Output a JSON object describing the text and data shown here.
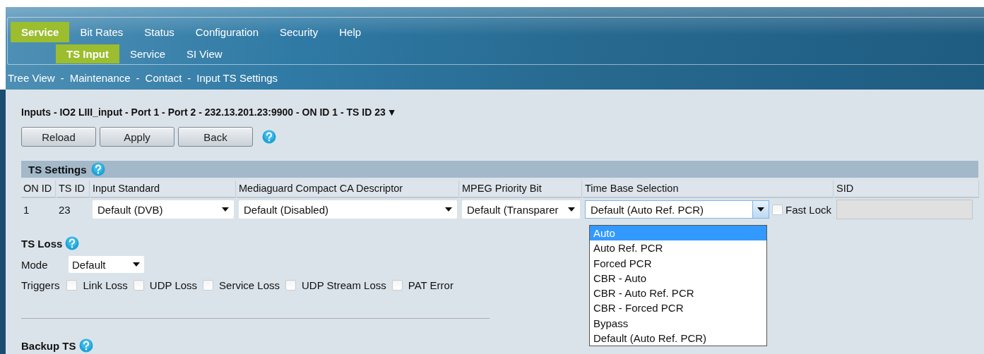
{
  "menu": [
    {
      "label": "Service",
      "selected": true
    },
    {
      "label": "Bit Rates",
      "selected": false
    },
    {
      "label": "Status",
      "selected": false
    },
    {
      "label": "Configuration",
      "selected": false
    },
    {
      "label": "Security",
      "selected": false
    },
    {
      "label": "Help",
      "selected": false
    }
  ],
  "submenu": [
    {
      "label": "TS Input",
      "selected": true
    },
    {
      "label": "Service",
      "selected": false
    },
    {
      "label": "SI View",
      "selected": false
    }
  ],
  "breadcrumb": [
    "Tree View",
    "-",
    "Maintenance",
    "-",
    "Contact",
    "-",
    "Input TS Settings"
  ],
  "page_title": {
    "text": "Inputs - IO2 LIII_input - Port 1 - Port 2 - 232.13.201.23:9900 - ON ID 1 - TS ID 23",
    "toggle": "▼"
  },
  "buttons": [
    "Reload",
    "Apply",
    "Back"
  ],
  "ts_settings": {
    "title": "TS Settings",
    "columns": [
      "ON ID",
      "TS ID",
      "Input Standard",
      "Mediaguard Compact CA Descriptor",
      "MPEG Priority Bit",
      "Time Base Selection",
      "SID"
    ],
    "row": [
      {
        "kind": "text",
        "value": "1"
      },
      {
        "kind": "text",
        "value": "23"
      },
      {
        "kind": "select",
        "value": "Default (DVB)"
      },
      {
        "kind": "select",
        "value": "Default (Disabled)"
      },
      {
        "kind": "select",
        "value": "Default (Transparer"
      },
      {
        "kind": "timebase",
        "value": "Default (Auto Ref. PCR)",
        "expanded": true,
        "options": [
          {
            "label": "Auto",
            "highlighted": true
          },
          {
            "label": "Auto Ref. PCR",
            "highlighted": false
          },
          {
            "label": "Forced PCR",
            "highlighted": false
          },
          {
            "label": "CBR - Auto",
            "highlighted": false
          },
          {
            "label": "CBR - Auto Ref. PCR",
            "highlighted": false
          },
          {
            "label": "CBR - Forced PCR",
            "highlighted": false
          },
          {
            "label": "Bypass",
            "highlighted": false
          },
          {
            "label": "Default (Auto Ref. PCR)",
            "highlighted": false
          }
        ],
        "fast_lock": {
          "label": "Fast Lock",
          "checked": false
        }
      },
      {
        "kind": "input",
        "disabled": true
      }
    ]
  },
  "ts_loss": {
    "title": "TS Loss",
    "mode": {
      "label": "Mode",
      "value": "Default"
    },
    "triggers": {
      "label": "Triggers",
      "items": [
        {
          "label": "Link Loss",
          "checked": false
        },
        {
          "label": "UDP Loss",
          "checked": false
        },
        {
          "label": "Service Loss",
          "checked": false
        },
        {
          "label": "UDP Stream Loss",
          "checked": false
        },
        {
          "label": "PAT Error",
          "checked": false
        }
      ]
    }
  },
  "backup_ts": {
    "title": "Backup TS"
  }
}
